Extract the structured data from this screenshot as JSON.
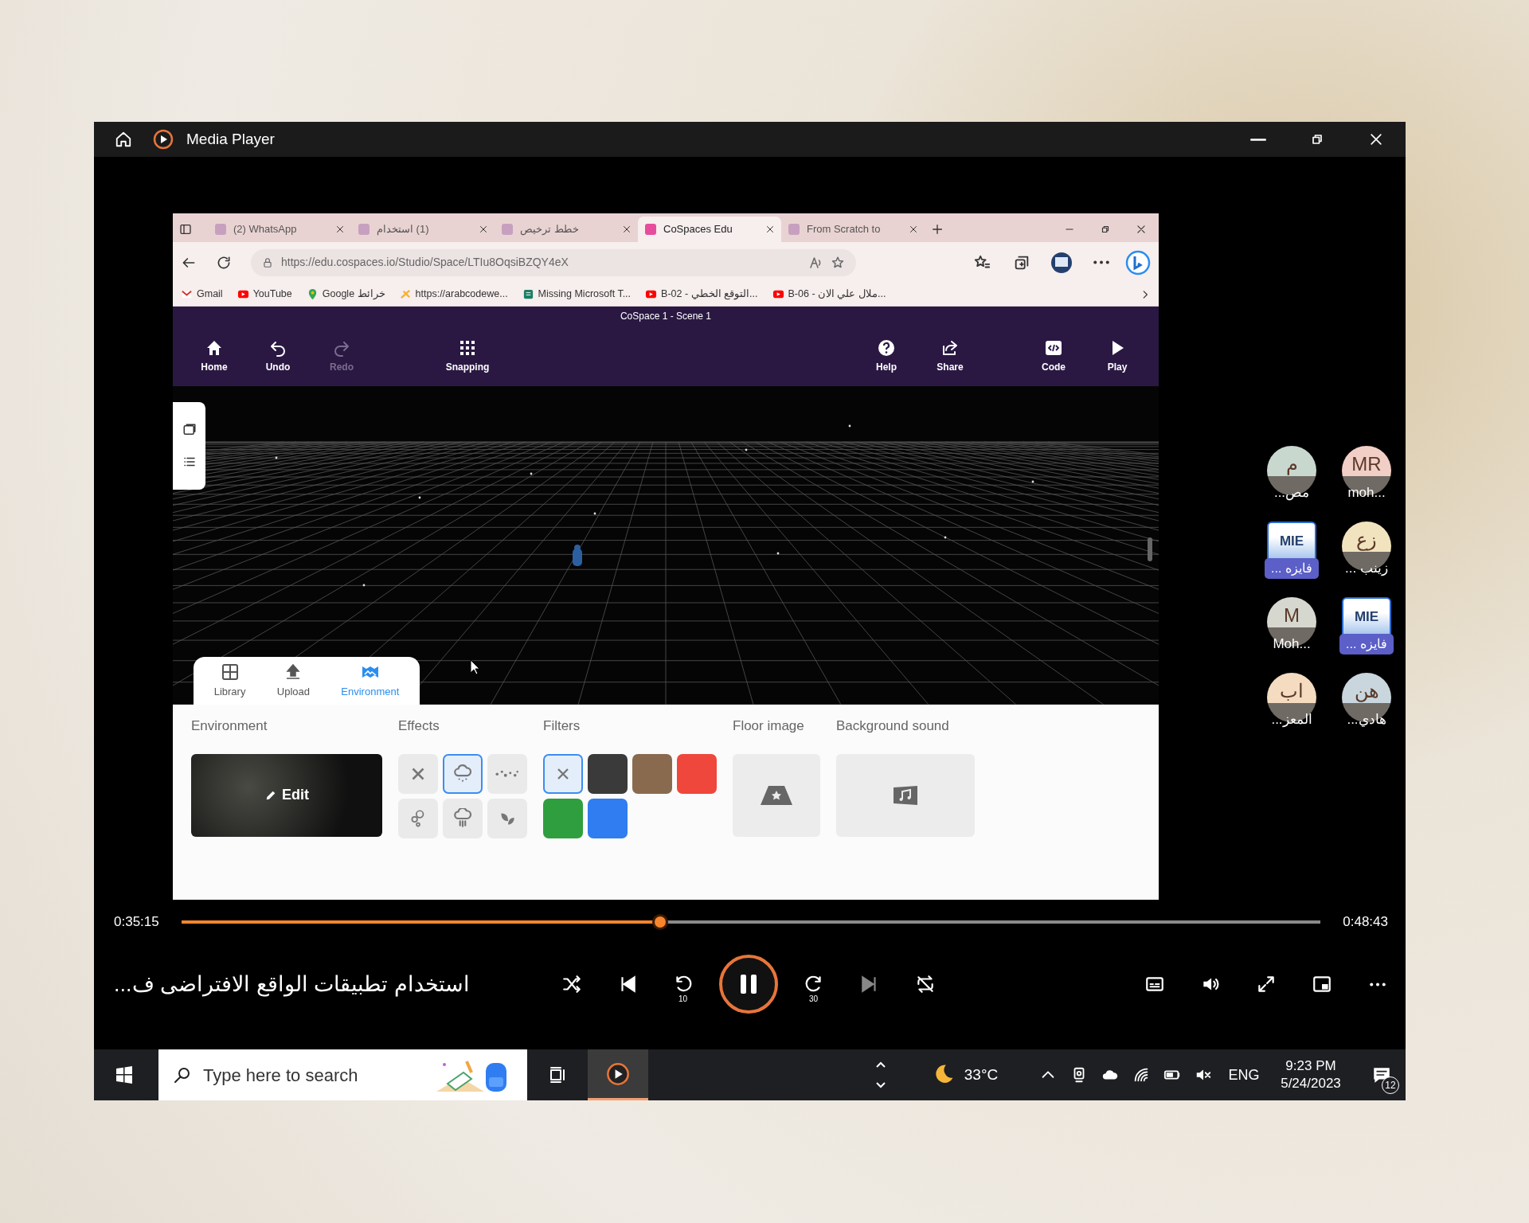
{
  "player": {
    "title": "Media Player"
  },
  "browser": {
    "tabs": [
      {
        "label": "(2) WhatsApp",
        "selected": false
      },
      {
        "label": "(1) استخدام",
        "selected": false
      },
      {
        "label": "خطط ترخيص",
        "selected": false
      },
      {
        "label": "CoSpaces Edu",
        "selected": true
      },
      {
        "label": "From Scratch to",
        "selected": false
      }
    ],
    "url": "https://edu.cospaces.io/Studio/Space/LTIu8OqsiBZQY4eX",
    "bookmarks": [
      {
        "kind": "mail",
        "label": "Gmail"
      },
      {
        "kind": "video",
        "label": "YouTube"
      },
      {
        "kind": "map",
        "label": "Google خرائط"
      },
      {
        "kind": "star",
        "label": "https://arabcodewe..."
      },
      {
        "kind": "doc",
        "label": "Missing Microsoft T..."
      },
      {
        "kind": "video",
        "label": "B-02 - التوقع الخطي..."
      },
      {
        "kind": "video",
        "label": "B-06 - ملال علي الان..."
      }
    ]
  },
  "cospaces": {
    "scene_title": "CoSpace 1 - Scene 1",
    "toolbar_left": [
      {
        "kind": "home",
        "label": "Home",
        "disabled": false
      },
      {
        "kind": "undo",
        "label": "Undo",
        "disabled": false
      },
      {
        "kind": "redo",
        "label": "Redo",
        "disabled": true
      }
    ],
    "toolbar_center": [
      {
        "kind": "grid",
        "label": "Snapping",
        "disabled": false
      }
    ],
    "toolbar_right": [
      {
        "kind": "help",
        "label": "Help",
        "disabled": false
      },
      {
        "kind": "share",
        "label": "Share",
        "disabled": false
      },
      {
        "kind": "code",
        "label": "Code",
        "disabled": false
      },
      {
        "kind": "play",
        "label": "Play",
        "disabled": false
      }
    ],
    "panel_tabs": [
      {
        "kind": "library",
        "label": "Library",
        "selected": false
      },
      {
        "kind": "upload",
        "label": "Upload",
        "selected": false
      },
      {
        "kind": "environment",
        "label": "Environment",
        "selected": true
      }
    ],
    "environment": {
      "heading": "Environment",
      "edit_label": "Edit"
    },
    "effects": {
      "heading": "Effects",
      "items": [
        {
          "kind": "none",
          "selected": false
        },
        {
          "kind": "snow",
          "selected": true
        },
        {
          "kind": "dust",
          "selected": false
        },
        {
          "kind": "bubbles",
          "selected": false
        },
        {
          "kind": "rain",
          "selected": false
        },
        {
          "kind": "leaves",
          "selected": false
        }
      ]
    },
    "filters": {
      "heading": "Filters",
      "items": [
        {
          "kind": "none",
          "selected": true
        },
        {
          "kind": "swatch",
          "color": "#3a3a3a",
          "selected": false
        },
        {
          "kind": "swatch",
          "color": "#8a6a4e",
          "selected": false
        },
        {
          "kind": "swatch",
          "color": "#f0473c",
          "selected": false
        },
        {
          "kind": "swatch",
          "color": "#2f9e3f",
          "selected": false
        },
        {
          "kind": "swatch",
          "color": "#2f7df0",
          "selected": false
        }
      ]
    },
    "floor_image": {
      "heading": "Floor image"
    },
    "background_sound": {
      "heading": "Background sound"
    }
  },
  "participants": [
    {
      "kind": "avatar",
      "initials": "م",
      "name": "مص...",
      "color": "#c9d8cf"
    },
    {
      "kind": "picture",
      "picture_text": "MIE",
      "name": "فايزه ..."
    },
    {
      "kind": "avatar",
      "initials": "M",
      "name": "Moh...",
      "color": "#d6d8cf"
    },
    {
      "kind": "avatar",
      "initials": "اب",
      "name": "المعز...",
      "color": "#f5dcc0"
    },
    {
      "kind": "avatar",
      "initials": "MR",
      "name": "moh...",
      "color": "#f2cfc6"
    },
    {
      "kind": "avatar",
      "initials": "زع",
      "name": "زينب ...",
      "color": "#f2e3bf"
    },
    {
      "kind": "picture",
      "picture_text": "MIE",
      "name": "فايزه ..."
    },
    {
      "kind": "avatar",
      "initials": "هن",
      "name": "هادي...",
      "color": "#c9d6de"
    }
  ],
  "playback": {
    "elapsed": "0:35:15",
    "total": "0:48:43",
    "level": 0.42,
    "title": "استخدام تطبيقات الواقع الافتراضى ف...",
    "playing": true,
    "skip_back": "10",
    "skip_forward": "30"
  },
  "taskbar": {
    "search_placeholder": "Type here to search",
    "temperature": "33°C",
    "language": "ENG",
    "time": "9:23 PM",
    "date": "5/24/2023",
    "notifications": "12"
  }
}
